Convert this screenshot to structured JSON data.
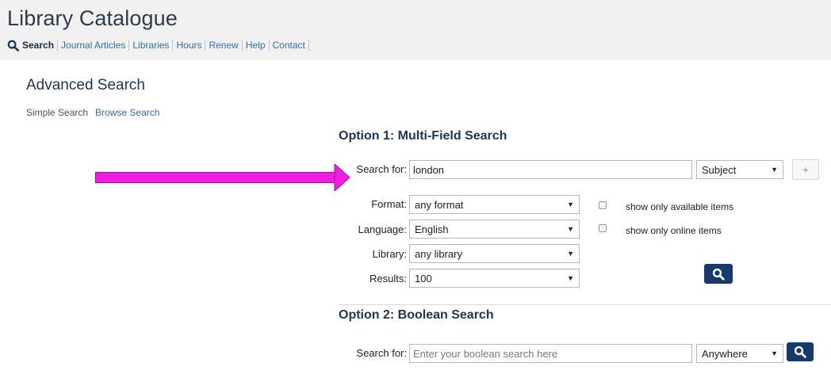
{
  "header": {
    "title": "Library Catalogue",
    "nav": [
      {
        "label": "Search"
      },
      {
        "label": "Journal Articles"
      },
      {
        "label": "Libraries"
      },
      {
        "label": "Hours"
      },
      {
        "label": "Renew"
      },
      {
        "label": "Help"
      },
      {
        "label": "Contact"
      }
    ]
  },
  "page": {
    "heading": "Advanced Search",
    "subnav": {
      "current": "Simple Search",
      "link": "Browse Search"
    }
  },
  "option1": {
    "title": "Option 1: Multi-Field Search",
    "search_label": "Search for:",
    "search_value": "london",
    "field_select": "Subject",
    "add_button": "+",
    "format_label": "Format:",
    "format_value": "any format",
    "language_label": "Language:",
    "language_value": "English",
    "library_label": "Library:",
    "library_value": "any library",
    "results_label": "Results:",
    "results_value": "100",
    "available_label": "show only available items",
    "online_label": "show only online items",
    "available_checked": false,
    "online_checked": false
  },
  "option2": {
    "title": "Option 2: Boolean Search",
    "search_label": "Search for:",
    "search_placeholder": "Enter your boolean search here",
    "field_select": "Anywhere"
  },
  "colors": {
    "accent": "#163a6b",
    "arrow": "#ee1fe0",
    "link": "#2f6fab"
  },
  "icons": {
    "search": "magnifier-icon",
    "caret": "caret-down-icon"
  }
}
